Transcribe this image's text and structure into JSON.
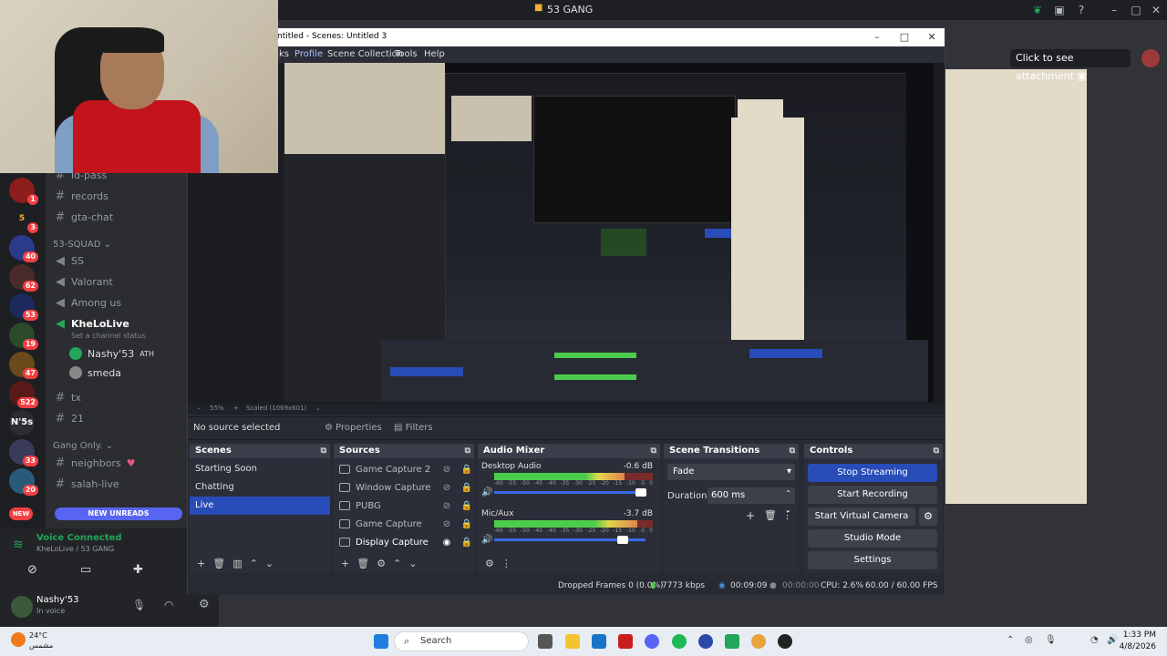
{
  "discord": {
    "window_title": "53 GANG",
    "attachment_pill": "Click to see attachment",
    "channels": [
      {
        "name": "id-pass"
      },
      {
        "name": "records"
      },
      {
        "name": "gta-chat"
      }
    ],
    "category_squad": "53-SQUAD",
    "squad_channels": [
      "SS",
      "Valorant",
      "Among us"
    ],
    "voice_channel": "KheLoLive",
    "voice_status": "Set a channel status",
    "voice_users": [
      {
        "name": "Nashy'53",
        "tag": "ATH"
      },
      {
        "name": "smeda",
        "tag": ""
      }
    ],
    "more_channels": [
      "tx",
      "21"
    ],
    "category_gang": "Gang Only.",
    "gang_channels": [
      "neighbors",
      "salah-live"
    ],
    "new_unreads": "NEW UNREADS",
    "new_badge": "NEW",
    "voice_connected": "Voice Connected",
    "voice_connected_sub": "KheLoLive / 53 GANG",
    "user_name": "Nashy'53",
    "user_status": "In voice",
    "server_badges": [
      "1",
      "3",
      "40",
      "62",
      "53",
      "19",
      "47",
      "522",
      "",
      "33",
      "20"
    ],
    "n5s_label": "N'5s"
  },
  "obs": {
    "title": "ntitled - Scenes: Untitled 3",
    "menu": [
      "ks",
      "Profile",
      "Scene Collection",
      "Tools",
      "Help"
    ],
    "zoom": "55%",
    "scaled": "Scaled (1069x601)",
    "no_source": "No source selected",
    "properties_label": "Properties",
    "filters_label": "Filters",
    "docks": {
      "scenes": "Scenes",
      "sources": "Sources",
      "mixer": "Audio Mixer",
      "transitions": "Scene Transitions",
      "controls": "Controls"
    },
    "scenes": [
      "Starting Soon",
      "Chatting",
      "Live"
    ],
    "active_scene": "Live",
    "sources": [
      "Game Capture 2",
      "Window Capture",
      "PUBG",
      "Game Capture",
      "Display Capture"
    ],
    "mixer": [
      {
        "name": "Desktop Audio",
        "db": "-0.6 dB",
        "level": 0.82,
        "volume": 0.97
      },
      {
        "name": "Mic/Aux",
        "db": "-3.7 dB",
        "level": 0.9,
        "volume": 0.85
      }
    ],
    "meter_scale": [
      "-60",
      "-55",
      "-50",
      "-45",
      "-40",
      "-35",
      "-30",
      "-25",
      "-20",
      "-15",
      "-10",
      "-5",
      "0"
    ],
    "transition": {
      "type": "Fade",
      "duration_label": "Duration",
      "duration": "600 ms"
    },
    "controls": [
      "Stop Streaming",
      "Start Recording",
      "Start Virtual Camera",
      "Studio Mode",
      "Settings"
    ],
    "status": {
      "dropped": "Dropped Frames 0 (0.0%)",
      "kbps": "7773 kbps",
      "live_time": "00:09:09",
      "rec_time": "00:00:00",
      "cpu": "CPU: 2.6%",
      "fps": "60.00 / 60.00 FPS"
    }
  },
  "taskbar": {
    "weather_temp": "24°C",
    "weather_desc": "مشمس",
    "search": "Search",
    "time": "1:33 PM",
    "date": "4/8/2026"
  },
  "colors": {
    "obs_accent": "#284cb8",
    "discord_green": "#23a55a",
    "discord_red": "#f23f43"
  }
}
